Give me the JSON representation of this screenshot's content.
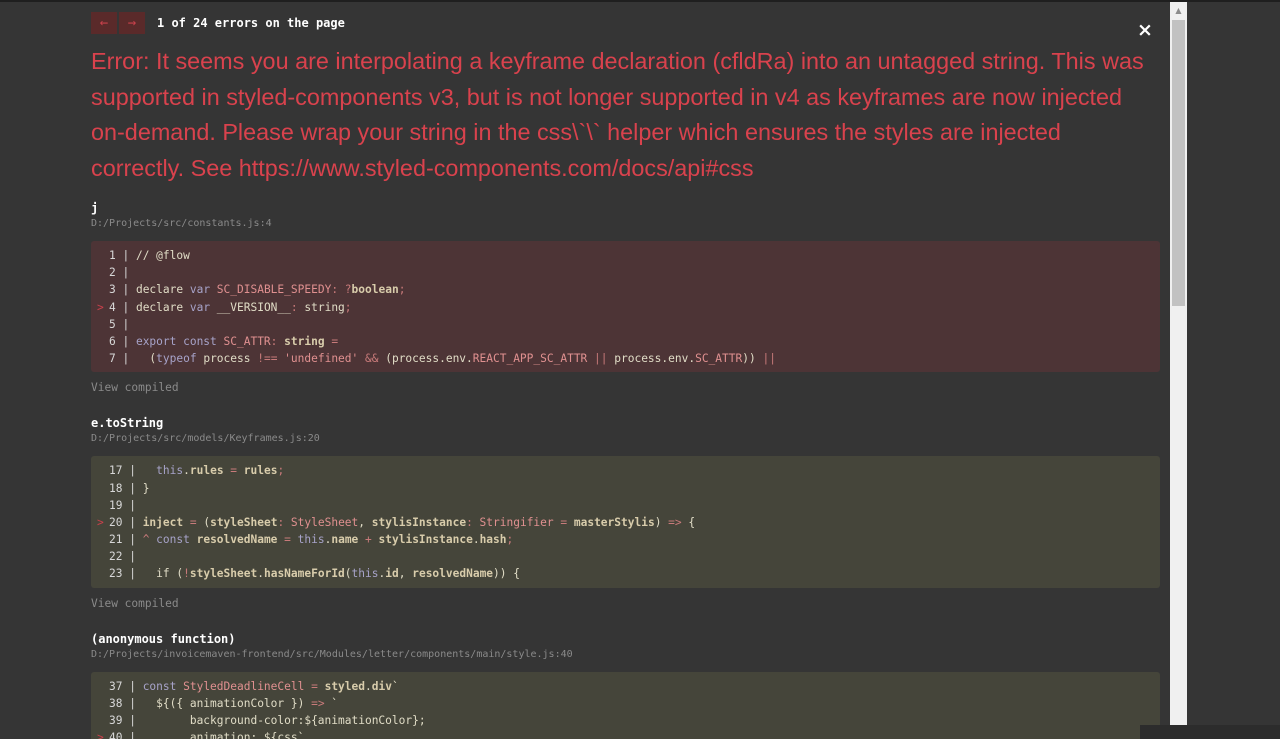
{
  "nav": {
    "prev_icon": "←",
    "next_icon": "→",
    "count_text": "1 of 24 errors on the page"
  },
  "close_icon": "×",
  "error_message": "Error: It seems you are interpolating a keyframe declaration (cfldRa) into an untagged string. This was supported in styled-components v3, but is not longer supported in v4 as keyframes are now injected on-demand. Please wrap your string in the css\\`\\` helper which ensures the styles are injected correctly. See https://www.styled-components.com/docs/api#css",
  "frames": [
    {
      "function": "j",
      "file": "D:/Projects/src/constants.js:4",
      "highlight": "red",
      "view_compiled": "View compiled",
      "lines": [
        {
          "marker": "",
          "num": "1",
          "tokens": [
            [
              "txt",
              "// @flow"
            ]
          ]
        },
        {
          "marker": "",
          "num": "2",
          "tokens": []
        },
        {
          "marker": "",
          "num": "3",
          "tokens": [
            [
              "txt",
              "declare "
            ],
            [
              "kw",
              "var "
            ],
            [
              "str",
              "SC_DISABLE_SPEEDY"
            ],
            [
              "op",
              ": "
            ],
            [
              "op",
              "?"
            ],
            [
              "id",
              "boolean"
            ],
            [
              "op",
              ";"
            ]
          ]
        },
        {
          "marker": ">",
          "num": "4",
          "tokens": [
            [
              "txt",
              "declare "
            ],
            [
              "kw",
              "var "
            ],
            [
              "txt",
              "__VERSION__"
            ],
            [
              "op",
              ": "
            ],
            [
              "txt",
              "string"
            ],
            [
              "op",
              ";"
            ]
          ]
        },
        {
          "marker": "",
          "num": "5",
          "tokens": []
        },
        {
          "marker": "",
          "num": "6",
          "tokens": [
            [
              "kw",
              "export const "
            ],
            [
              "str",
              "SC_ATTR"
            ],
            [
              "op",
              ": "
            ],
            [
              "id",
              "string"
            ],
            [
              "op",
              " ="
            ]
          ]
        },
        {
          "marker": "",
          "num": "7",
          "tokens": [
            [
              "txt",
              "  ("
            ],
            [
              "kw",
              "typeof "
            ],
            [
              "txt",
              "process "
            ],
            [
              "op",
              "!== "
            ],
            [
              "str",
              "'undefined'"
            ],
            [
              "op",
              " && "
            ],
            [
              "txt",
              "(process.env."
            ],
            [
              "str",
              "REACT_APP_SC_ATTR"
            ],
            [
              "op",
              " || "
            ],
            [
              "txt",
              "process.env."
            ],
            [
              "str",
              "SC_ATTR"
            ],
            [
              "txt",
              ")) "
            ],
            [
              "op",
              "||"
            ]
          ]
        }
      ]
    },
    {
      "function": "e.toString",
      "file": "D:/Projects/src/models/Keyframes.js:20",
      "highlight": "olive",
      "view_compiled": "View compiled",
      "lines": [
        {
          "marker": "",
          "num": "17",
          "tokens": [
            [
              "txt",
              "  "
            ],
            [
              "kw",
              "this"
            ],
            [
              "txt",
              "."
            ],
            [
              "id",
              "rules"
            ],
            [
              "op",
              " = "
            ],
            [
              "id",
              "rules"
            ],
            [
              "op",
              ";"
            ]
          ]
        },
        {
          "marker": "",
          "num": "18",
          "tokens": [
            [
              "txt",
              "}"
            ]
          ]
        },
        {
          "marker": "",
          "num": "19",
          "tokens": []
        },
        {
          "marker": ">",
          "num": "20",
          "tokens": [
            [
              "id",
              "inject"
            ],
            [
              "op",
              " = "
            ],
            [
              "txt",
              "("
            ],
            [
              "id",
              "styleSheet"
            ],
            [
              "op",
              ": "
            ],
            [
              "str",
              "StyleSheet"
            ],
            [
              "txt",
              ", "
            ],
            [
              "id",
              "stylisInstance"
            ],
            [
              "op",
              ": "
            ],
            [
              "str",
              "Stringifier"
            ],
            [
              "op",
              " = "
            ],
            [
              "id",
              "masterStylis"
            ],
            [
              "txt",
              ") "
            ],
            [
              "op",
              "=> "
            ],
            [
              "txt",
              "{"
            ]
          ]
        },
        {
          "marker": "",
          "num": "21",
          "tokens": [
            [
              "op",
              "^ "
            ],
            [
              "kw",
              "const "
            ],
            [
              "id",
              "resolvedName"
            ],
            [
              "op",
              " = "
            ],
            [
              "kw",
              "this"
            ],
            [
              "txt",
              "."
            ],
            [
              "id",
              "name"
            ],
            [
              "op",
              " + "
            ],
            [
              "id",
              "stylisInstance"
            ],
            [
              "txt",
              "."
            ],
            [
              "id",
              "hash"
            ],
            [
              "op",
              ";"
            ]
          ]
        },
        {
          "marker": "",
          "num": "22",
          "tokens": []
        },
        {
          "marker": "",
          "num": "23",
          "tokens": [
            [
              "txt",
              "  if ("
            ],
            [
              "op",
              "!"
            ],
            [
              "id",
              "styleSheet"
            ],
            [
              "txt",
              "."
            ],
            [
              "id",
              "hasNameForId"
            ],
            [
              "txt",
              "("
            ],
            [
              "kw",
              "this"
            ],
            [
              "txt",
              "."
            ],
            [
              "id",
              "id"
            ],
            [
              "txt",
              ", "
            ],
            [
              "id",
              "resolvedName"
            ],
            [
              "txt",
              ")) {"
            ]
          ]
        }
      ]
    },
    {
      "function": "(anonymous function)",
      "file": "D:/Projects/invoicemaven-frontend/src/Modules/letter/components/main/style.js:40",
      "highlight": "olive",
      "view_compiled": "",
      "lines": [
        {
          "marker": "",
          "num": "37",
          "tokens": [
            [
              "kw",
              "const "
            ],
            [
              "str",
              "StyledDeadlineCell"
            ],
            [
              "op",
              " = "
            ],
            [
              "id",
              "styled"
            ],
            [
              "txt",
              "."
            ],
            [
              "id",
              "div"
            ],
            [
              "txt",
              "`"
            ]
          ]
        },
        {
          "marker": "",
          "num": "38",
          "tokens": [
            [
              "txt",
              "  ${({ animationColor }) "
            ],
            [
              "op",
              "=> "
            ],
            [
              "txt",
              "`"
            ]
          ]
        },
        {
          "marker": "",
          "num": "39",
          "tokens": [
            [
              "txt",
              "       background-color:${animationColor};"
            ]
          ]
        },
        {
          "marker": ">",
          "num": "40",
          "tokens": [
            [
              "txt",
              "       animation: ${css`"
            ]
          ]
        }
      ]
    }
  ]
}
